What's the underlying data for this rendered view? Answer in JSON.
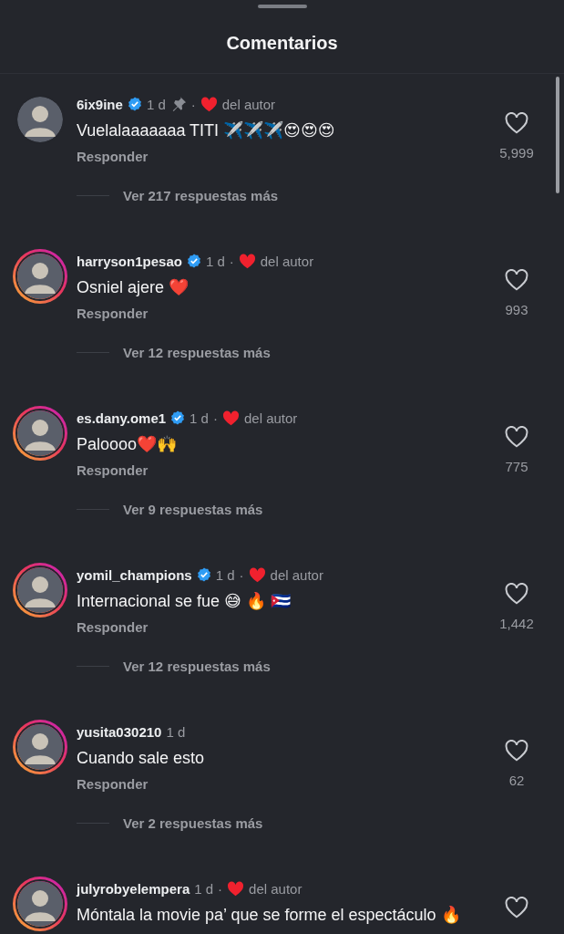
{
  "header": {
    "title": "Comentarios"
  },
  "comments": [
    {
      "user": "6ix9ine",
      "verified": true,
      "time": "1 d",
      "pinned": true,
      "story_ring": false,
      "separator": "·",
      "author_like": "del autor",
      "text": "Vuelalaaaaaaa TITI ✈️✈️✈️😍😍😍",
      "reply_label": "Responder",
      "likes": "5,999",
      "replies": "Ver 217 respuestas más"
    },
    {
      "user": "harryson1pesao",
      "verified": true,
      "time": "1 d",
      "pinned": false,
      "story_ring": true,
      "separator": "·",
      "author_like": "del autor",
      "text": "Osniel ajere ❤️",
      "reply_label": "Responder",
      "likes": "993",
      "replies": "Ver 12 respuestas más"
    },
    {
      "user": "es.dany.ome1",
      "verified": true,
      "time": "1 d",
      "pinned": false,
      "story_ring": true,
      "separator": "·",
      "author_like": "del autor",
      "text": "Paloooo❤️🙌",
      "reply_label": "Responder",
      "likes": "775",
      "replies": "Ver 9 respuestas más"
    },
    {
      "user": "yomil_champions",
      "verified": true,
      "time": "1 d",
      "pinned": false,
      "story_ring": true,
      "separator": "·",
      "author_like": "del autor",
      "text": "Internacional se fue 😅 🔥 🇨🇺",
      "reply_label": "Responder",
      "likes": "1,442",
      "replies": "Ver 12 respuestas más"
    },
    {
      "user": "yusita030210",
      "verified": false,
      "time": "1 d",
      "pinned": false,
      "story_ring": true,
      "text": "Cuando sale esto",
      "reply_label": "Responder",
      "likes": "62",
      "replies": "Ver 2 respuestas más"
    },
    {
      "user": "julyrobyelempera",
      "verified": false,
      "time": "1 d",
      "pinned": false,
      "story_ring": true,
      "separator": "·",
      "author_like": "del autor",
      "text": "Móntala la movie pa’ que se forme el espectáculo 🔥"
    }
  ]
}
